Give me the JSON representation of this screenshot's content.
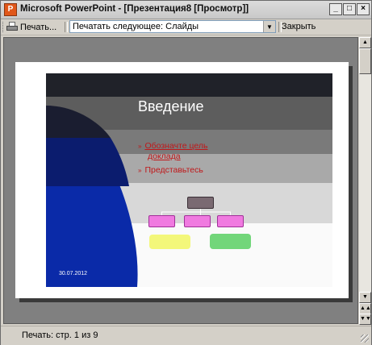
{
  "window": {
    "title": "Microsoft PowerPoint - [Презентация8 [Просмотр]]",
    "app_icon_letter": "P",
    "buttons": {
      "minimize": "_",
      "maximize": "□",
      "close": "×"
    }
  },
  "toolbar": {
    "print_label": "Печать...",
    "print_what_value": "Печатать следующее: Слайды",
    "close_label": "Закрыть"
  },
  "slide": {
    "title": "Введение",
    "bullets": [
      {
        "line1": "Обозначте цель",
        "line2": "доклада"
      },
      {
        "line1": "Представьтесь"
      }
    ],
    "bullet_marker": "»",
    "date": "30.07.2012"
  },
  "scrollbar": {
    "up": "▲",
    "down": "▼",
    "page_up": "▲▲",
    "page_down": "▼▼"
  },
  "status": {
    "text": "Печать: стр. 1 из 9"
  },
  "icons": [
    "app-icon",
    "printer-icon",
    "dropdown-arrow-icon",
    "minimize-icon",
    "maximize-icon",
    "close-icon"
  ],
  "colors": {
    "titlebar": "#d6d6d6",
    "workspace": "#808080",
    "slide_title": "#ffffff",
    "bullet_text": "#c0181a",
    "blue_shape": "#0a2aa8",
    "org_top": "#7a6a72",
    "org_mid": "#f07ae0",
    "org_yellow": "#f3f77a",
    "org_green": "#72d67a"
  }
}
